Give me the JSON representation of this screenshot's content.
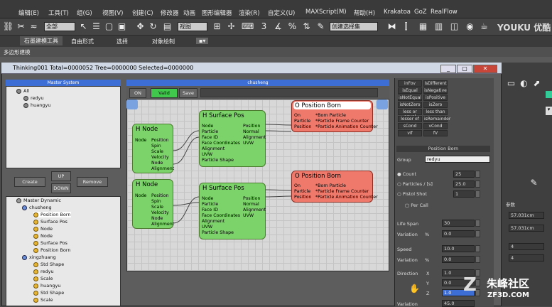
{
  "menu": [
    "编辑(E)",
    "工具(T)",
    "组(G)",
    "视图(V)",
    "创建(C)",
    "修改器",
    "动画",
    "图形编辑器",
    "渲染(R)",
    "自定义(U)",
    "MAXScript(M)",
    "帮助(H)",
    "Krakatoa",
    "GoZ",
    "RealFlow"
  ],
  "toolbar": {
    "selection_filter": "全部",
    "view_dropdown": "视图",
    "named_set": "创建选择集"
  },
  "ribbon": {
    "tabs": [
      "石墨建模工具",
      "自由形式",
      "选择",
      "对象绘制"
    ],
    "sub_label": "多边形建模"
  },
  "window": {
    "title": "Thinking001  Total=0000052  Tree=0000000  Selected=0000000"
  },
  "master_system": {
    "header": "Master System",
    "items": [
      "All",
      "redyu",
      "huangyu"
    ]
  },
  "buttons": {
    "up": "UP",
    "down": "DOWN",
    "create": "Create",
    "remove": "Remove"
  },
  "master_dynamic": {
    "items": [
      "Master Dynamic",
      "chusheng",
      "Position Born",
      "Surface Pos",
      "Node",
      "Node",
      "Surface Pos",
      "Position Born",
      "xingzhuang",
      "Std Shape",
      "redyu",
      "Scale",
      "huangyu",
      "Std Shape",
      "Scale"
    ]
  },
  "canvas": {
    "header": "chusheng",
    "on": "ON",
    "valid": "Valid",
    "save": "Save"
  },
  "nodes": {
    "h_node_title": "H Node",
    "h_node_left": "Node",
    "h_node_ports": [
      "Position",
      "Spin",
      "Scale",
      "Velocity",
      "Node",
      "Alignment"
    ],
    "surface_title": "H Surface Pos",
    "surface_left": [
      "Node",
      "Particle",
      "Face ID",
      "Face Coordinates",
      "Alignment",
      "UVW",
      "Particle Shape"
    ],
    "surface_right": [
      "Position",
      "Normal",
      "Alignment",
      "UVW"
    ],
    "born_title": "O Position Born",
    "born_left": [
      "On",
      "Particle",
      "Position"
    ],
    "born_right": [
      "*Born Particle",
      "*Particle Frame Counter",
      "*Particle Animation Counter"
    ]
  },
  "right_panel": {
    "conditions": [
      "inFov",
      "isDifferent",
      "isEqual",
      "isNegative",
      "isNotEqual",
      "isPositive",
      "isNotZero",
      "isZero",
      "less or equal",
      "less than",
      "lesser of",
      "isRemainder",
      "sCond",
      "vCond",
      "vif",
      "fV"
    ],
    "section": "Position Born",
    "group_label": "Group",
    "group_value": "redyu",
    "count_label": "Count",
    "count_value": "25",
    "particles_label": "Particles / [s]",
    "particles_value": "25.0",
    "pistol_label": "Pistol Shot",
    "pistol_value": "1",
    "per_call": "Per Call",
    "life_label": "Life Span",
    "life_value": "30",
    "var1": "Variation",
    "pct": "%",
    "var1_value": "0.0",
    "speed_label": "Speed",
    "speed_value": "10.0",
    "var2_value": "0.0",
    "dir_label": "Direction",
    "dx": "X",
    "dx_value": "1.0",
    "dy": "Y",
    "dy_value": "0.0",
    "dz": "Z",
    "dz_value": "1.0",
    "var3_value": "45.0"
  },
  "far_right": {
    "v1": "57.031cm",
    "v2": "57.031cm",
    "v3": "4",
    "v4": "4",
    "v5": "参数"
  },
  "watermarks": {
    "youku": "YOUKU 优酷",
    "site": "朱峰社区",
    "url": "ZF3D.COM"
  }
}
